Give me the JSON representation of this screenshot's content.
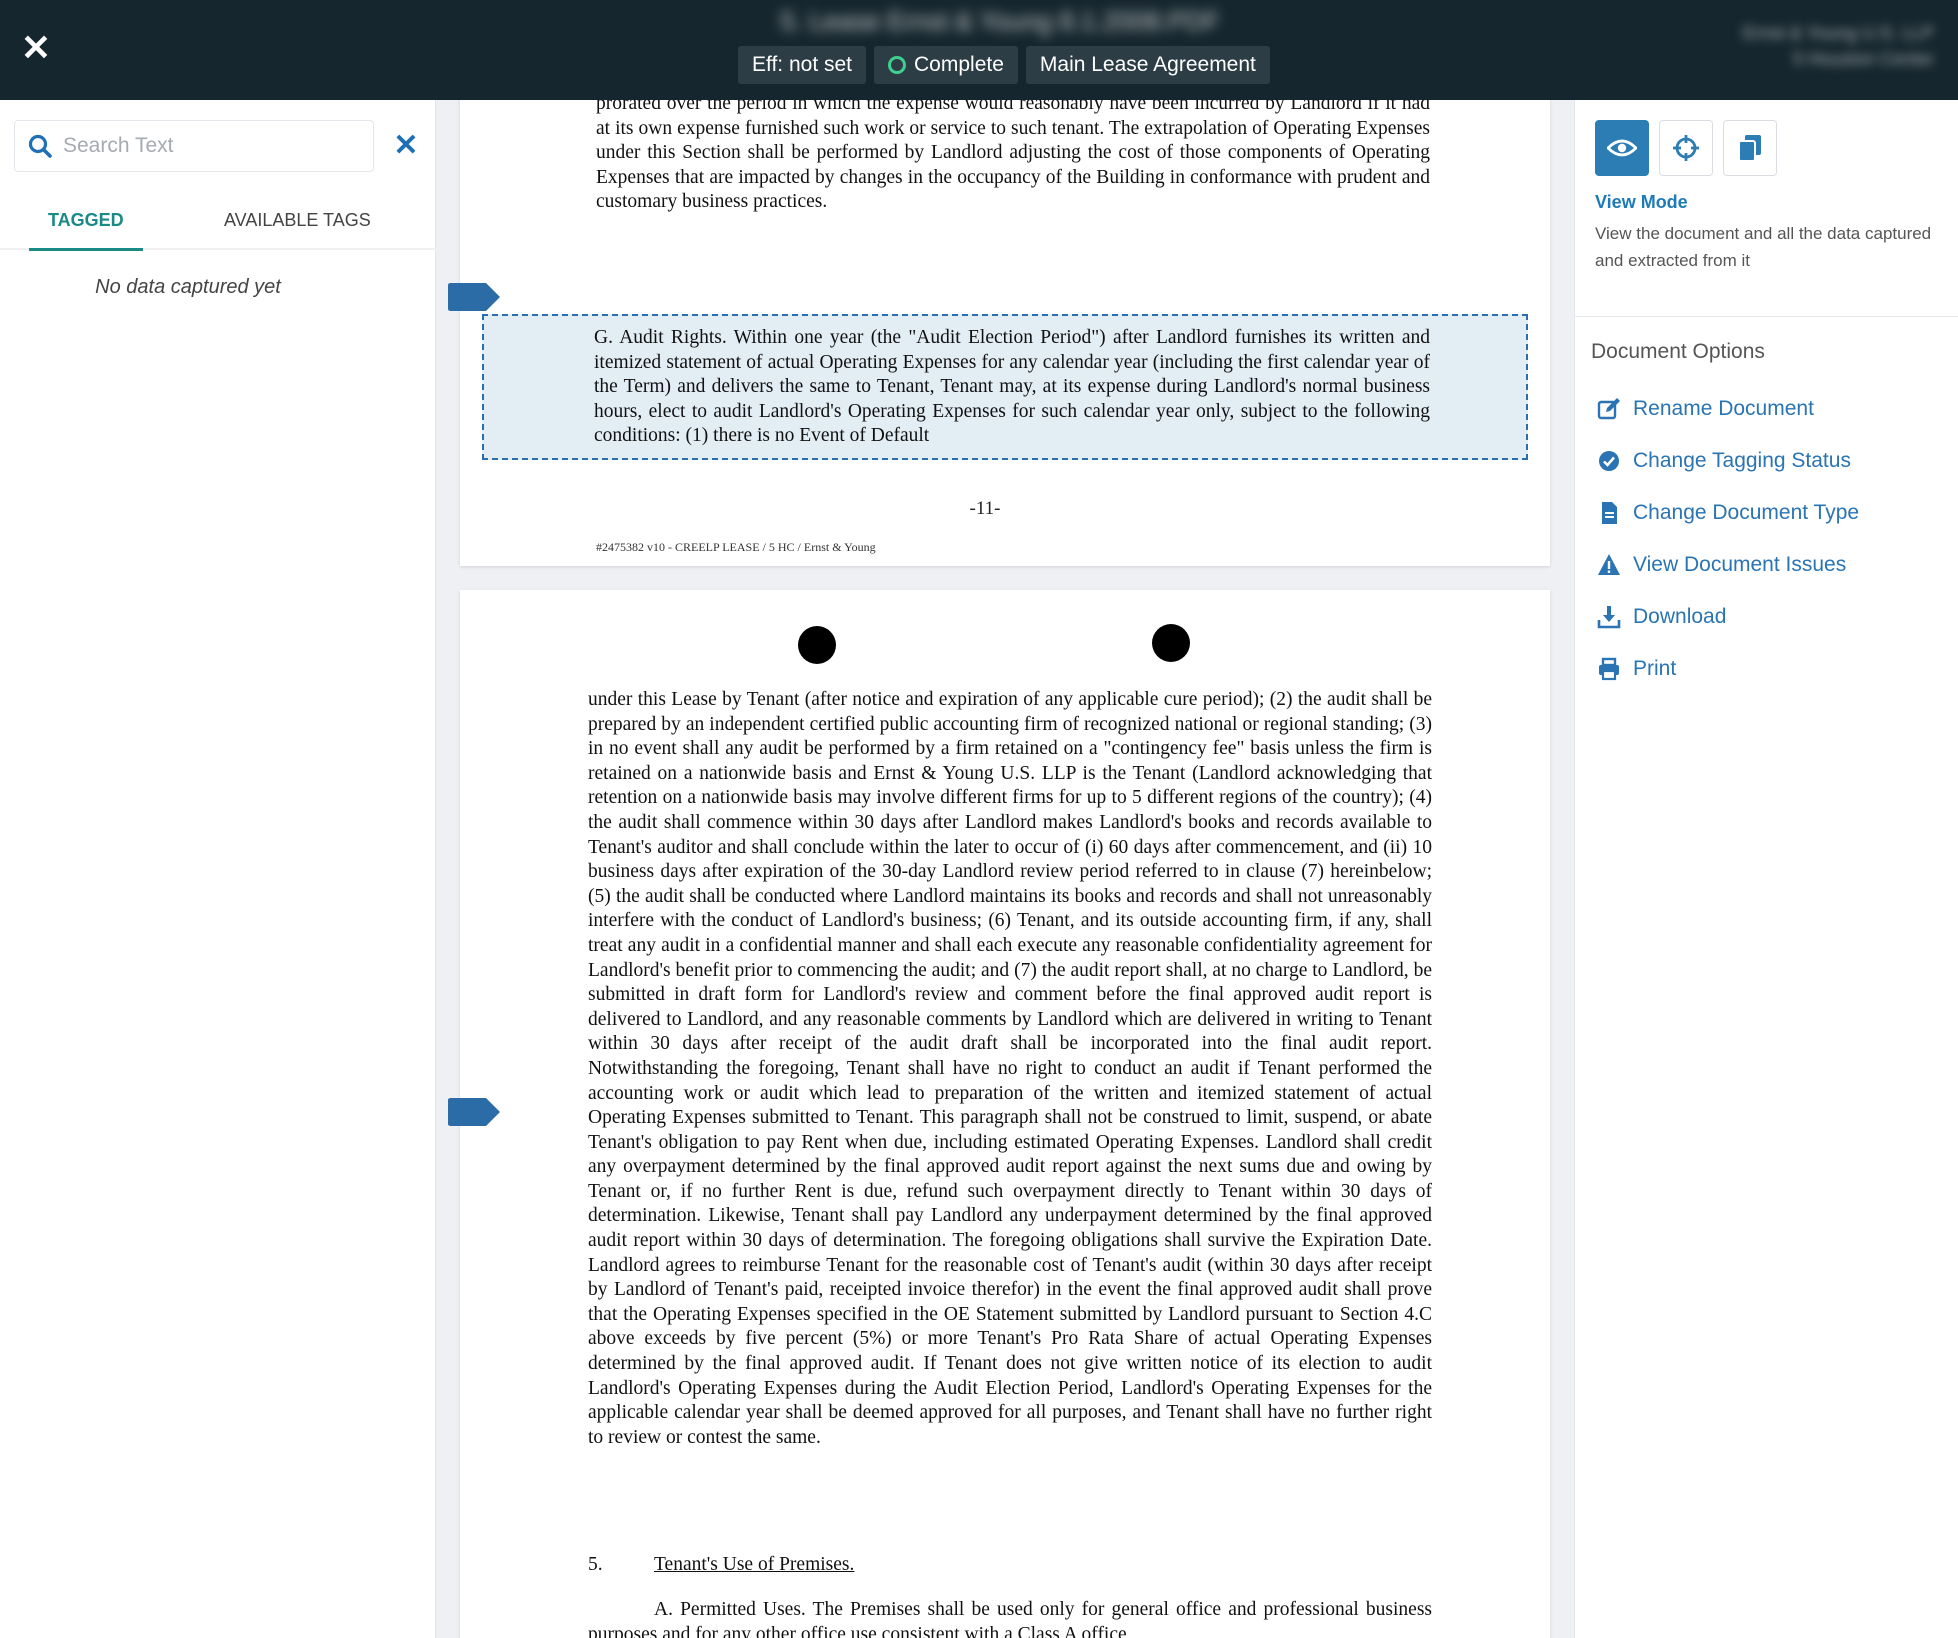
{
  "header": {
    "title": "5. Lease Ernst & Young 8.1.2008.PDF",
    "chips": {
      "effective": "Eff: not set",
      "status": "Complete",
      "doc_type": "Main Lease Agreement"
    },
    "account_line1": "Ernst & Young U.S. LLP",
    "account_line2": "5 Houston Center"
  },
  "left_panel": {
    "search_placeholder": "Search Text",
    "tabs": [
      "TAGGED",
      "AVAILABLE TAGS"
    ],
    "empty_message": "No data captured yet"
  },
  "document": {
    "page1_text": "prorated over the period in which the expense would reasonably have been incurred by Landlord if it had at its own expense furnished such work or service to such tenant. The extrapolation of Operating Expenses under this Section shall be performed by Landlord adjusting the cost of those components of Operating Expenses that are impacted by changes in the occupancy of the Building in conformance with prudent and customary business practices.",
    "highlight_text": "G. Audit Rights. Within one year (the \"Audit Election Period\") after Landlord furnishes its written and itemized statement of actual Operating Expenses for any calendar year (including the first calendar year of the Term) and delivers the same to Tenant, Tenant may, at its expense during Landlord's normal business hours, elect to audit Landlord's Operating Expenses for such calendar year only, subject to the following conditions: (1) there is no Event of Default",
    "page_number": "-11-",
    "footer_ref": "#2475382 v10 - CREELP LEASE / 5 HC / Ernst & Young",
    "page2_text": "under this Lease by Tenant (after notice and expiration of any applicable cure period); (2) the audit shall be prepared by an independent certified public accounting firm of recognized national or regional standing; (3) in no event shall any audit be performed by a firm retained on a \"contingency fee\" basis unless the firm is retained on a nationwide basis and Ernst & Young U.S. LLP is the Tenant (Landlord acknowledging that retention on a nationwide basis may involve different firms for up to 5 different regions of the country); (4) the audit shall commence within 30 days after Landlord makes Landlord's books and records available to Tenant's auditor and shall conclude within the later to occur of (i) 60 days after commencement, and (ii) 10 business days after expiration of the 30-day Landlord review period referred to in clause (7) hereinbelow; (5) the audit shall be conducted where Landlord maintains its books and records and shall not unreasonably interfere with the conduct of Landlord's business; (6) Tenant, and its outside accounting firm, if any, shall treat any audit in a confidential manner and shall each execute any reasonable confidentiality agreement for Landlord's benefit prior to commencing the audit; and (7) the audit report shall, at no charge to Landlord, be submitted in draft form for Landlord's review and comment before the final approved audit report is delivered to Landlord, and any reasonable comments by Landlord which are delivered in writing to Tenant within 30 days after receipt of the audit draft shall be incorporated into the final audit report. Notwithstanding the foregoing, Tenant shall have no right to conduct an audit if Tenant performed the accounting work or audit which lead to preparation of the written and itemized statement of actual Operating Expenses submitted to Tenant. This paragraph shall not be construed to limit, suspend, or abate Tenant's obligation to pay Rent when due, including estimated Operating Expenses. Landlord shall credit any overpayment determined by the final approved audit report against the next sums due and owing by Tenant or, if no further Rent is due, refund such overpayment directly to Tenant within 30 days of determination. Likewise, Tenant shall pay Landlord any underpayment determined by the final approved audit report within 30 days of determination. The foregoing obligations shall survive the Expiration Date. Landlord agrees to reimburse Tenant for the reasonable cost of Tenant's audit (within 30 days after receipt by Landlord of Tenant's paid, receipted invoice therefor) in the event the final approved audit shall prove that the Operating Expenses specified in the OE Statement submitted by Landlord pursuant to Section 4.C above exceeds by five percent (5%) or more Tenant's Pro Rata Share of actual Operating Expenses determined by the final approved audit. If Tenant does not give written notice of its election to audit Landlord's Operating Expenses during the Audit Election Period, Landlord's Operating Expenses for the applicable calendar year shall be deemed approved for all purposes, and Tenant shall have no further right to review or contest the same.",
    "section_number": "5.",
    "section_title": "Tenant's Use of Premises.",
    "page2_bottom": "A. Permitted Uses. The Premises shall be used only for general office and professional business purposes and for any other office use consistent with a Class A office"
  },
  "right_panel": {
    "mode_title": "View Mode",
    "mode_desc": "View the document and all the data captured and extracted from it",
    "options_title": "Document Options",
    "options": [
      "Rename Document",
      "Change Tagging Status",
      "Change Document Type",
      "View Document Issues",
      "Download",
      "Print"
    ]
  },
  "colors": {
    "header_bg": "#16262e",
    "accent_blue": "#2b7db3",
    "tab_teal": "#1a8a86",
    "status_green": "#3fcf8e",
    "highlight_bg": "#e3edf4"
  },
  "icons": [
    "close-icon",
    "search-icon",
    "clear-icon",
    "eye-icon",
    "crosshair-icon",
    "copy-icon",
    "edit-icon",
    "check-circle-icon",
    "file-icon",
    "warning-icon",
    "download-icon",
    "printer-icon",
    "tag-marker-icon"
  ]
}
